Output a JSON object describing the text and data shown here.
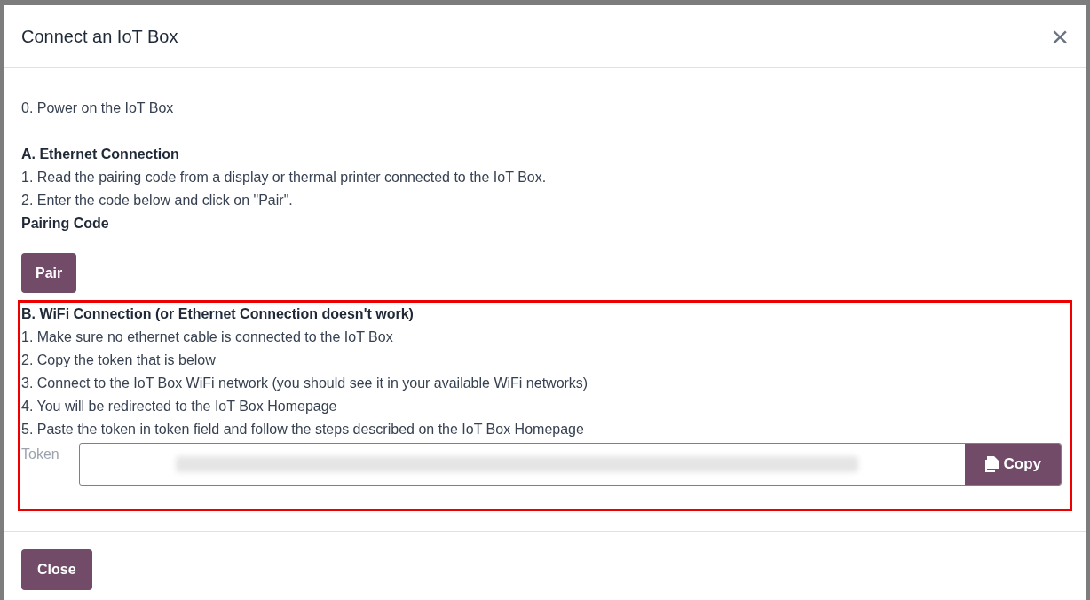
{
  "dialog": {
    "title": "Connect an IoT Box",
    "close_icon": "×",
    "intro": "0. Power on the IoT Box",
    "ethernet": {
      "heading": "A. Ethernet Connection",
      "steps": [
        "1. Read the pairing code from a display or thermal printer connected to the IoT Box.",
        "2. Enter the code below and click on \"Pair\"."
      ],
      "field_label": "Pairing Code",
      "button": "Pair"
    },
    "wifi": {
      "heading": "B. WiFi Connection (or Ethernet Connection doesn't work)",
      "steps": [
        "1. Make sure no ethernet cable is connected to the IoT Box",
        "2. Copy the token that is below",
        "3. Connect to the IoT Box WiFi network (you should see it in your available WiFi networks)",
        "4. You will be redirected to the IoT Box Homepage",
        "5. Paste the token in token field and follow the steps described on the IoT Box Homepage"
      ],
      "token_label": "Token",
      "copy_button": "Copy"
    },
    "footer_button": "Close"
  }
}
